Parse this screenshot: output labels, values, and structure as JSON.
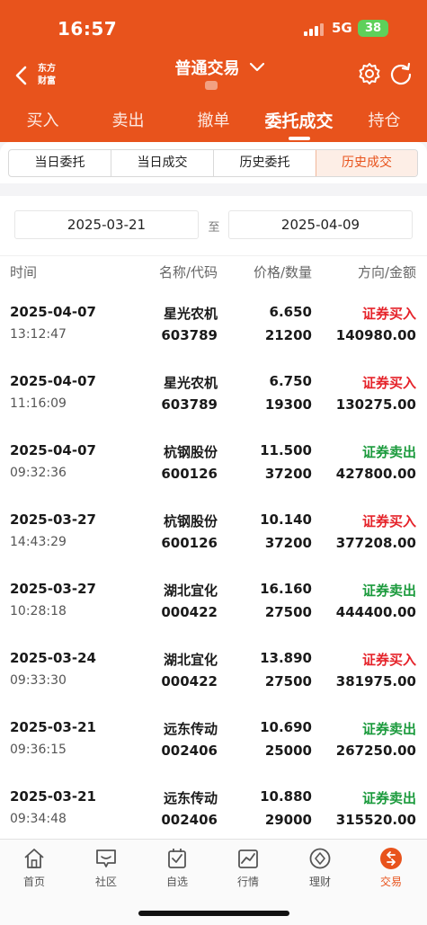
{
  "status": {
    "time": "16:57",
    "network": "5G",
    "battery": "38"
  },
  "colors": {
    "brand": "#e8531c",
    "buy": "#e5232a",
    "sell": "#1a9a3c"
  },
  "header": {
    "logo_line1": "东方",
    "logo_line2": "财富",
    "title": "普通交易"
  },
  "main_tabs": [
    {
      "label": "买入"
    },
    {
      "label": "卖出"
    },
    {
      "label": "撤单"
    },
    {
      "label": "委托成交"
    },
    {
      "label": "持仓"
    }
  ],
  "sub_tabs": [
    {
      "label": "当日委托"
    },
    {
      "label": "当日成交"
    },
    {
      "label": "历史委托"
    },
    {
      "label": "历史成交"
    }
  ],
  "date_range": {
    "start": "2025-03-21",
    "separator": "至",
    "end": "2025-04-09"
  },
  "columns": {
    "time": "时间",
    "name_code": "名称/代码",
    "price_qty": "价格/数量",
    "dir_amount": "方向/金额"
  },
  "rows": [
    {
      "date": "2025-04-07",
      "time": "13:12:47",
      "name": "星光农机",
      "code": "603789",
      "price": "6.650",
      "qty": "21200",
      "direction": "证券买入",
      "side": "buy",
      "amount": "140980.00"
    },
    {
      "date": "2025-04-07",
      "time": "11:16:09",
      "name": "星光农机",
      "code": "603789",
      "price": "6.750",
      "qty": "19300",
      "direction": "证券买入",
      "side": "buy",
      "amount": "130275.00"
    },
    {
      "date": "2025-04-07",
      "time": "09:32:36",
      "name": "杭钢股份",
      "code": "600126",
      "price": "11.500",
      "qty": "37200",
      "direction": "证券卖出",
      "side": "sell",
      "amount": "427800.00"
    },
    {
      "date": "2025-03-27",
      "time": "14:43:29",
      "name": "杭钢股份",
      "code": "600126",
      "price": "10.140",
      "qty": "37200",
      "direction": "证券买入",
      "side": "buy",
      "amount": "377208.00"
    },
    {
      "date": "2025-03-27",
      "time": "10:28:18",
      "name": "湖北宜化",
      "code": "000422",
      "price": "16.160",
      "qty": "27500",
      "direction": "证券卖出",
      "side": "sell",
      "amount": "444400.00"
    },
    {
      "date": "2025-03-24",
      "time": "09:33:30",
      "name": "湖北宜化",
      "code": "000422",
      "price": "13.890",
      "qty": "27500",
      "direction": "证券买入",
      "side": "buy",
      "amount": "381975.00"
    },
    {
      "date": "2025-03-21",
      "time": "09:36:15",
      "name": "远东传动",
      "code": "002406",
      "price": "10.690",
      "qty": "25000",
      "direction": "证券卖出",
      "side": "sell",
      "amount": "267250.00"
    },
    {
      "date": "2025-03-21",
      "time": "09:34:48",
      "name": "远东传动",
      "code": "002406",
      "price": "10.880",
      "qty": "29000",
      "direction": "证券卖出",
      "side": "sell",
      "amount": "315520.00"
    }
  ],
  "bottom_nav": [
    {
      "label": "首页",
      "icon": "home-icon"
    },
    {
      "label": "社区",
      "icon": "community-icon"
    },
    {
      "label": "自选",
      "icon": "watchlist-icon"
    },
    {
      "label": "行情",
      "icon": "market-icon"
    },
    {
      "label": "理财",
      "icon": "finance-icon"
    },
    {
      "label": "交易",
      "icon": "trade-icon"
    }
  ]
}
